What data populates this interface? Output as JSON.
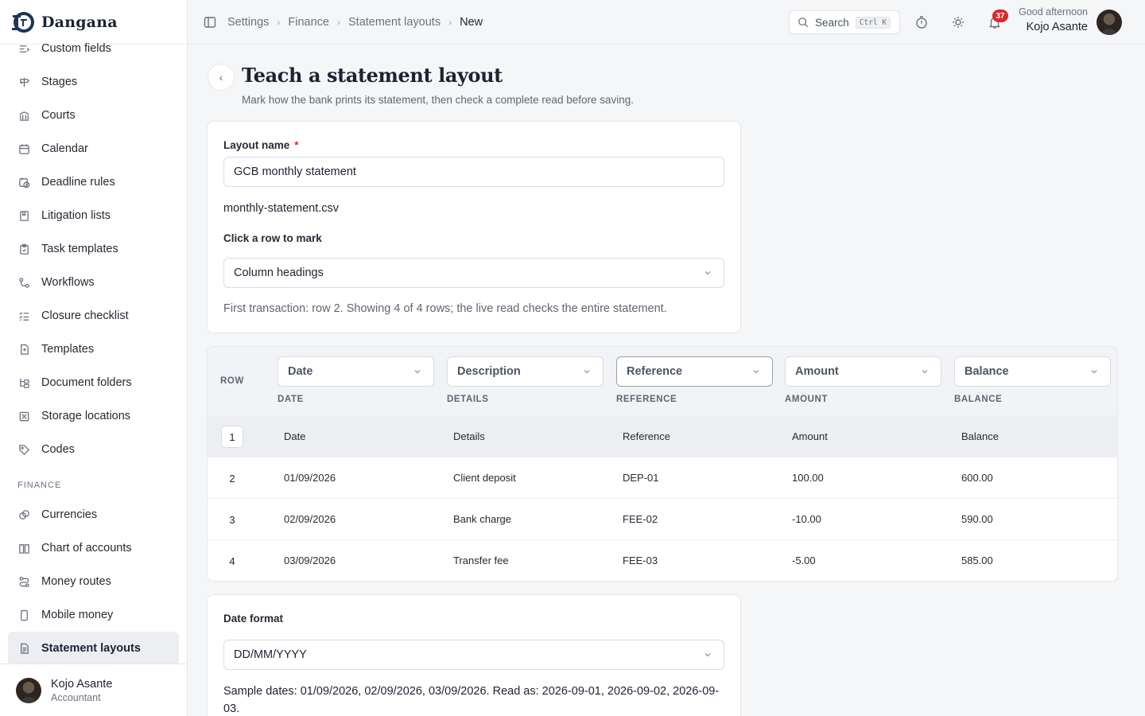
{
  "brand": {
    "name": "Dangana"
  },
  "sidebar": {
    "items": [
      {
        "label": "Custom fields",
        "icon": "custom-fields-icon"
      },
      {
        "label": "Stages",
        "icon": "signpost-icon"
      },
      {
        "label": "Courts",
        "icon": "courthouse-icon"
      },
      {
        "label": "Calendar",
        "icon": "calendar-icon"
      },
      {
        "label": "Deadline rules",
        "icon": "calendar-clock-icon"
      },
      {
        "label": "Litigation lists",
        "icon": "list-book-icon"
      },
      {
        "label": "Task templates",
        "icon": "clipboard-icon"
      },
      {
        "label": "Workflows",
        "icon": "workflow-icon"
      },
      {
        "label": "Closure checklist",
        "icon": "checklist-icon"
      },
      {
        "label": "Templates",
        "icon": "file-template-icon"
      },
      {
        "label": "Document folders",
        "icon": "folder-tree-icon"
      },
      {
        "label": "Storage locations",
        "icon": "archive-box-icon"
      },
      {
        "label": "Codes",
        "icon": "tag-icon"
      }
    ],
    "finance_section": "FINANCE",
    "finance_items": [
      {
        "label": "Currencies",
        "icon": "coins-icon"
      },
      {
        "label": "Chart of accounts",
        "icon": "book-open-icon"
      },
      {
        "label": "Money routes",
        "icon": "route-icon"
      },
      {
        "label": "Mobile money",
        "icon": "phone-icon"
      },
      {
        "label": "Statement layouts",
        "icon": "statement-icon",
        "active": true
      }
    ],
    "user": {
      "name": "Kojo Asante",
      "role": "Accountant"
    }
  },
  "topbar": {
    "breadcrumbs": [
      "Settings",
      "Finance",
      "Statement layouts",
      "New"
    ],
    "search_label": "Search",
    "search_shortcut": "Ctrl K",
    "notification_count": "37",
    "greeting": "Good afternoon",
    "user_name": "Kojo Asante"
  },
  "page": {
    "title": "Teach a statement layout",
    "subtitle": "Mark how the bank prints its statement, then check a complete read before saving."
  },
  "form": {
    "layout_name_label": "Layout name",
    "required_mark": "*",
    "layout_name_value": "GCB monthly statement",
    "file_name": "monthly-statement.csv",
    "row_mark_label": "Click a row to mark",
    "row_mark_value": "Column headings",
    "hint": "First transaction: row 2. Showing 4 of 4 rows; the live read checks the entire statement."
  },
  "mapping_table": {
    "row_header": "ROW",
    "columns": [
      {
        "select": "Date",
        "sub": "DATE"
      },
      {
        "select": "Description",
        "sub": "DETAILS"
      },
      {
        "select": "Reference",
        "sub": "REFERENCE"
      },
      {
        "select": "Amount",
        "sub": "AMOUNT"
      },
      {
        "select": "Balance",
        "sub": "BALANCE"
      }
    ],
    "rows": [
      {
        "n": "1",
        "cells": [
          "Date",
          "Details",
          "Reference",
          "Amount",
          "Balance"
        ]
      },
      {
        "n": "2",
        "cells": [
          "01/09/2026",
          "Client deposit",
          "DEP-01",
          "100.00",
          "600.00"
        ]
      },
      {
        "n": "3",
        "cells": [
          "02/09/2026",
          "Bank charge",
          "FEE-02",
          "-10.00",
          "590.00"
        ]
      },
      {
        "n": "4",
        "cells": [
          "03/09/2026",
          "Transfer fee",
          "FEE-03",
          "-5.00",
          "585.00"
        ]
      }
    ]
  },
  "date_format": {
    "label": "Date format",
    "value": "DD/MM/YYYY",
    "sample": "Sample dates: 01/09/2026, 02/09/2026, 03/09/2026. Read as: 2026-09-01, 2026-09-02, 2026-09-03."
  }
}
